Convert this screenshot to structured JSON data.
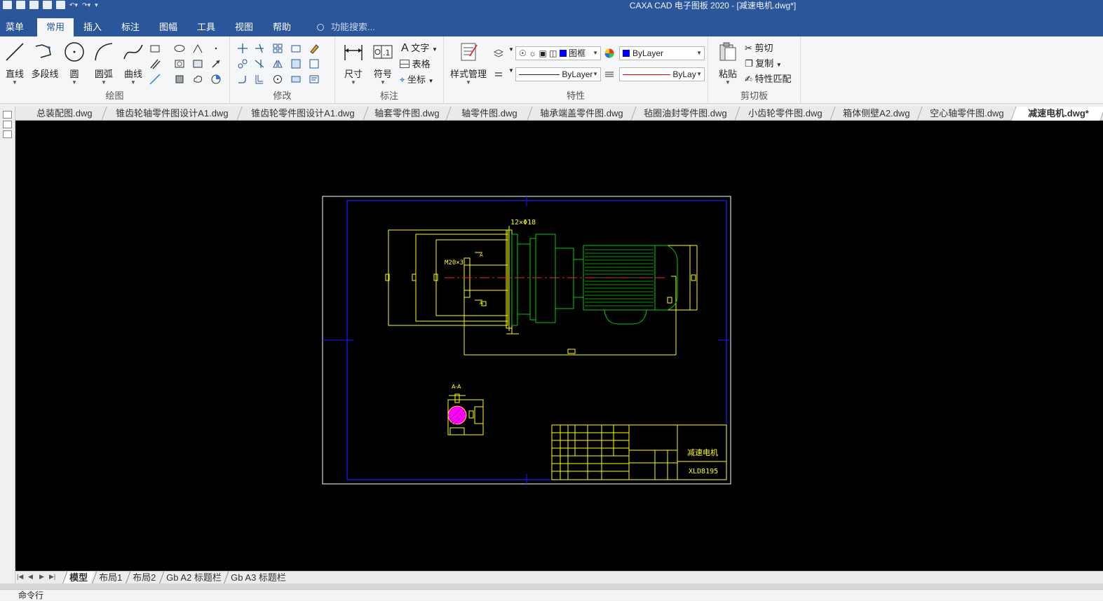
{
  "window": {
    "title": "CAXA CAD 电子图板 2020 - [减速电机.dwg*]"
  },
  "ribbon_tabs": [
    "菜单",
    "常用",
    "插入",
    "标注",
    "图幅",
    "工具",
    "视图",
    "帮助"
  ],
  "active_tab": "常用",
  "search": {
    "placeholder": "功能搜索..."
  },
  "groups": {
    "draw": {
      "label": "绘图",
      "buttons": [
        "直线",
        "多段线",
        "圆",
        "圆弧",
        "曲线"
      ]
    },
    "modify": {
      "label": "修改"
    },
    "annotate": {
      "label": "标注",
      "buttons": [
        "尺寸",
        "符号"
      ],
      "small": [
        "文字",
        "表格",
        "坐标"
      ]
    },
    "properties": {
      "label": "特性",
      "style_manager": "样式管理",
      "layer_value": "图框",
      "color_value": "ByLayer",
      "linetype_value": "ByLayer",
      "lineweight_value": "ByLay"
    },
    "clipboard": {
      "label": "剪切板",
      "paste": "粘贴",
      "small": [
        "剪切",
        "复制",
        "特性匹配"
      ]
    }
  },
  "doc_tabs": [
    "总装配图.dwg",
    "锥齿轮轴零件图设计A1.dwg",
    "锥齿轮零件图设计A1.dwg",
    "轴套零件图.dwg",
    "轴零件图.dwg",
    "轴承端盖零件图.dwg",
    "毡圈油封零件图.dwg",
    "小齿轮零件图.dwg",
    "箱体侧壁A2.dwg",
    "空心轴零件图.dwg",
    "减速电机.dwg*"
  ],
  "active_doc": "减速电机.dwg*",
  "drawing": {
    "dim_holes": "12×Φ18",
    "dim_thread": "M20×3",
    "section_label": "A-A",
    "section_marks": [
      "A",
      "A"
    ],
    "title_name": "减速电机",
    "title_code": "XLD8195"
  },
  "layout_tabs": [
    "模型",
    "布局1",
    "布局2",
    "Gb A2 标题栏",
    "Gb A3 标题栏"
  ],
  "active_layout": "模型",
  "command_line": {
    "label": "命令行"
  },
  "colors": {
    "accent": "#2b579a",
    "canvas": "#000000",
    "yellow": "#ffff00",
    "green": "#00cc00",
    "frame_blue": "#1a1aff",
    "magenta": "#ff00ff",
    "red": "#ff2020"
  }
}
